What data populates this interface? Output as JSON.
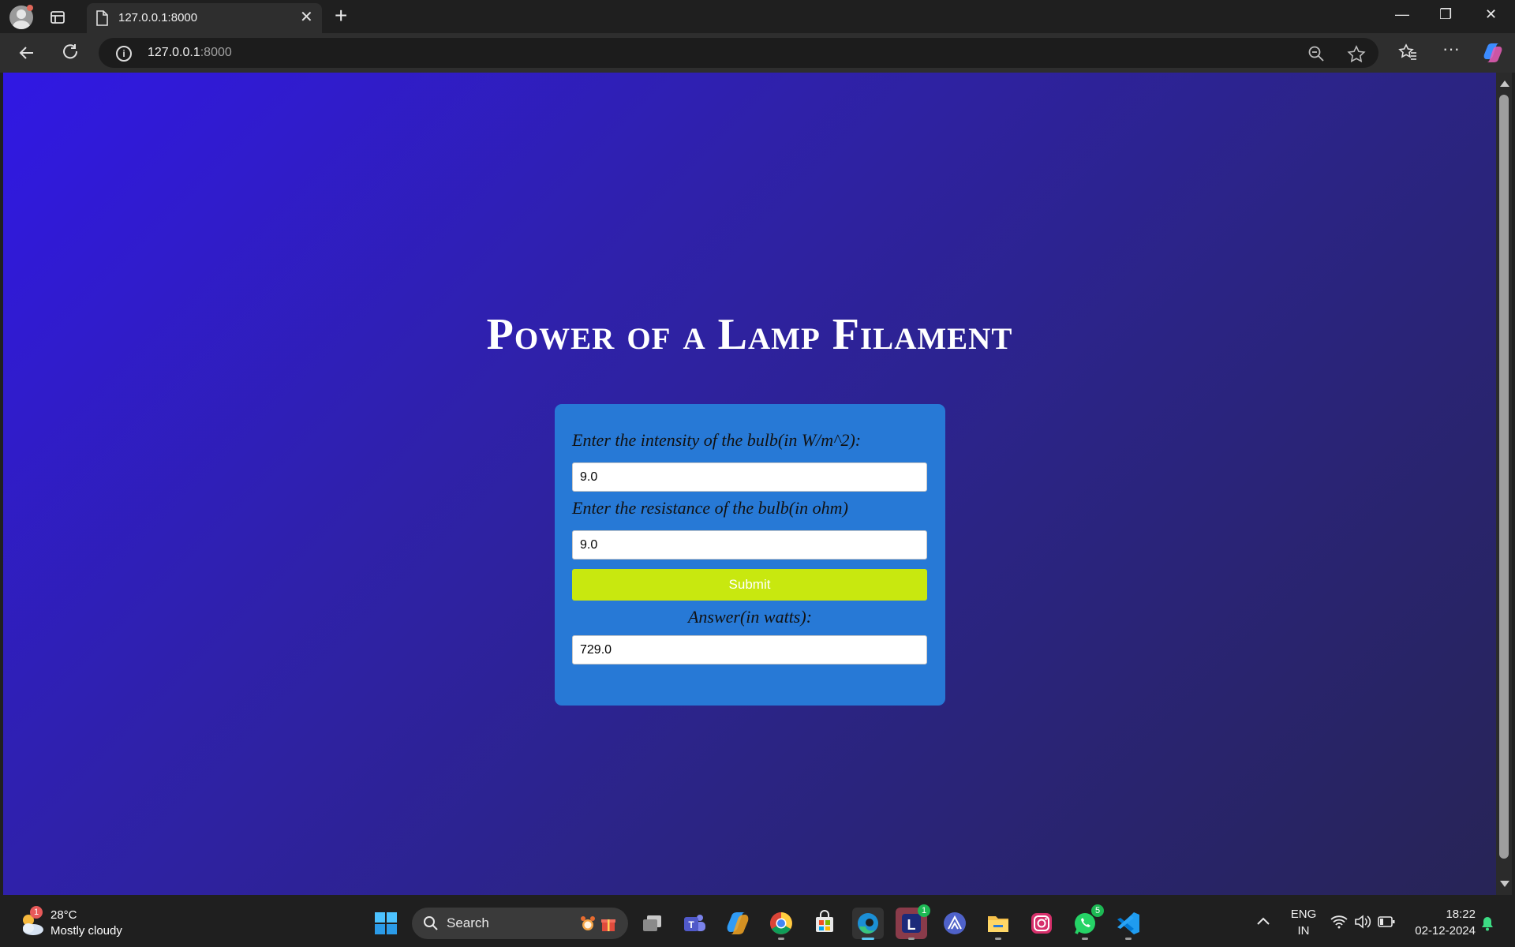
{
  "browser": {
    "tab_title": "127.0.0.1:8000",
    "url_host": "127.0.0.1",
    "url_port": ":8000",
    "new_tab_symbol": "+",
    "close_symbol": "✕",
    "window_min": "—",
    "window_restore": "❐",
    "window_close": "✕",
    "more_symbol": "···"
  },
  "page": {
    "title": "Power of a Lamp Filament",
    "intensity_label": "Enter the intensity of the bulb(in W/m^2):",
    "intensity_value": "9.0",
    "resistance_label": "Enter the resistance of the bulb(in ohm)",
    "resistance_value": "9.0",
    "submit_label": "Submit",
    "answer_label": "Answer(in watts):",
    "answer_value": "729.0"
  },
  "taskbar": {
    "weather_badge": "1",
    "temperature": "28°C",
    "condition": "Mostly cloudy",
    "search_label": "Search",
    "lens_badge": "1",
    "whatsapp_badge": "5",
    "language": "ENG",
    "region": "IN",
    "time": "18:22",
    "date": "02-12-2024"
  },
  "colors": {
    "card": "#2779d6",
    "submit": "#c8e80f",
    "bg_start": "#3018e4",
    "bg_end": "#272456"
  }
}
